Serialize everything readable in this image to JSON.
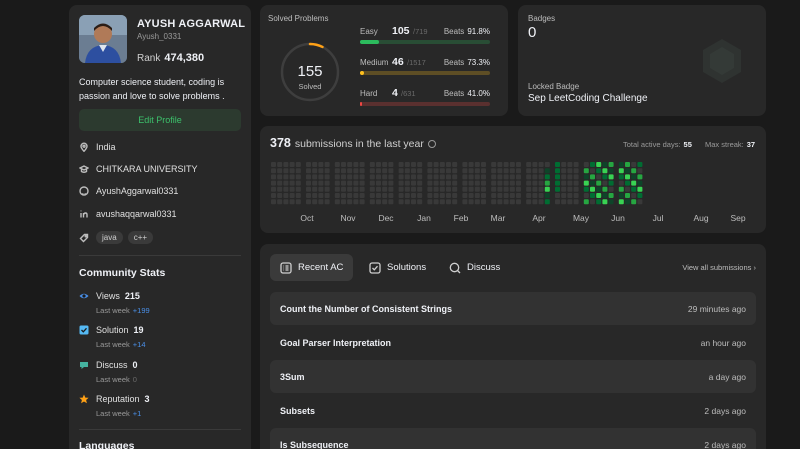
{
  "profile": {
    "display_name": "AYUSH AGGARWAL",
    "username": "Ayush_0331",
    "rank_label": "Rank",
    "rank_value": "474,380",
    "bio": "Computer science student, coding is passion and love to solve problems .",
    "edit_label": "Edit Profile",
    "location": "India",
    "university": "CHITKARA UNIVERSITY",
    "github": "AyushAggarwal0331",
    "linkedin": "avushaqqarwal0331",
    "skills": [
      "java",
      "c++"
    ]
  },
  "community": {
    "title": "Community Stats",
    "views": {
      "label": "Views",
      "value": "215",
      "sub_label": "Last week",
      "delta": "+199"
    },
    "solution": {
      "label": "Solution",
      "value": "19",
      "sub_label": "Last week",
      "delta": "+14"
    },
    "discuss": {
      "label": "Discuss",
      "value": "0",
      "sub_label": "Last week",
      "delta": "0"
    },
    "reputation": {
      "label": "Reputation",
      "value": "3",
      "sub_label": "Last week",
      "delta": "+1"
    },
    "next_title": "Languages"
  },
  "solved": {
    "title": "Solved Problems",
    "total": "155",
    "total_label": "Solved",
    "ring_fraction": 0.0735,
    "easy": {
      "name": "Easy",
      "count": "105",
      "total": "/719",
      "beats_label": "Beats",
      "beats": "91.8%",
      "fill": 0.146,
      "color": "#2cbb5d",
      "track": "#294d35"
    },
    "medium": {
      "name": "Medium",
      "count": "46",
      "total": "/1517",
      "beats_label": "Beats",
      "beats": "73.3%",
      "fill": 0.03,
      "color": "#ffc01e",
      "track": "#5e4e25"
    },
    "hard": {
      "name": "Hard",
      "count": "4",
      "total": "/631",
      "beats_label": "Beats",
      "beats": "41.0%",
      "fill": 0.006,
      "color": "#ef4743",
      "track": "#5a302f"
    }
  },
  "badges": {
    "title": "Badges",
    "count": "0",
    "locked_label": "Locked Badge",
    "locked_name": "Sep LeetCoding Challenge"
  },
  "heatmap": {
    "count": "378",
    "title": "submissions in the last year",
    "active_label": "Total active days:",
    "active_days": "55",
    "streak_label": "Max streak:",
    "max_streak": "37",
    "months": [
      "Oct",
      "Nov",
      "Dec",
      "Jan",
      "Feb",
      "Mar",
      "Apr",
      "May",
      "Jun",
      "Jul",
      "Aug",
      "Sep"
    ],
    "colors": {
      "empty": "#393939",
      "l1": "#0e4429",
      "l2": "#006d32",
      "l3": "#26a641",
      "l4": "#39d353"
    }
  },
  "recent": {
    "tabs": [
      {
        "label": "Recent AC",
        "icon": "list-icon"
      },
      {
        "label": "Solutions",
        "icon": "solution-icon"
      },
      {
        "label": "Discuss",
        "icon": "discuss-icon"
      }
    ],
    "view_all": "View all submissions",
    "items": [
      {
        "title": "Count the Number of Consistent Strings",
        "time": "29 minutes ago"
      },
      {
        "title": "Goal Parser Interpretation",
        "time": "an hour ago"
      },
      {
        "title": "3Sum",
        "time": "a day ago"
      },
      {
        "title": "Subsets",
        "time": "2 days ago"
      },
      {
        "title": "Is Subsequence",
        "time": "2 days ago"
      }
    ]
  }
}
